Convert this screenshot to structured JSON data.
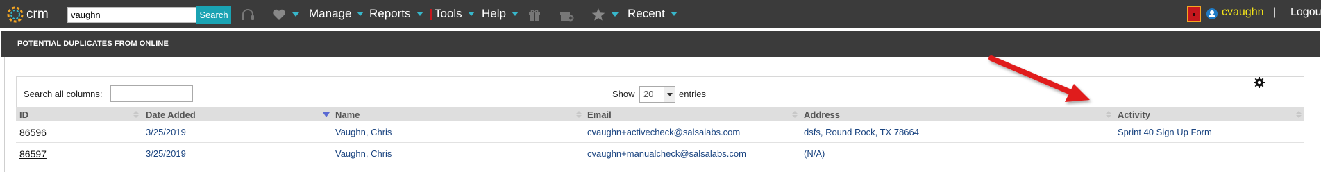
{
  "topnav": {
    "logo_text": "crm",
    "search_value": "vaughn",
    "search_button": "Search",
    "icons": [
      "headset-icon",
      "heart-icon",
      "gift-icon",
      "gift-plus-icon",
      "star-icon"
    ],
    "menus": {
      "manage": "Manage",
      "reports": "Reports",
      "tools": "Tools",
      "help": "Help",
      "recent": "Recent"
    },
    "username": "cvaughn",
    "separator": "|",
    "logout": "Logout"
  },
  "panel": {
    "title": "POTENTIAL DUPLICATES FROM ONLINE"
  },
  "table_controls": {
    "search_label": "Search all columns:",
    "search_value": "",
    "show_label": "Show",
    "page_length": "20",
    "entries_label": "entries"
  },
  "table": {
    "columns": [
      "ID",
      "Date Added",
      "Name",
      "Email",
      "Address",
      "Activity"
    ],
    "rows": [
      {
        "id": "86596",
        "date_added": "3/25/2019",
        "name": "Vaughn, Chris",
        "email": "cvaughn+activecheck@salsalabs.com",
        "address": "dsfs, Round Rock, TX 78664",
        "activity": "Sprint 40 Sign Up Form"
      },
      {
        "id": "86597",
        "date_added": "3/25/2019",
        "name": "Vaughn, Chris",
        "email": "cvaughn+manualcheck@salsalabs.com",
        "address": "(N/A)",
        "activity": ""
      }
    ]
  },
  "colors": {
    "nav_bg": "#3b3b3b",
    "accent": "#1aa3b3",
    "username": "#f5e51a",
    "link": "#1a4480",
    "annotation_arrow": "#e01b1b"
  }
}
